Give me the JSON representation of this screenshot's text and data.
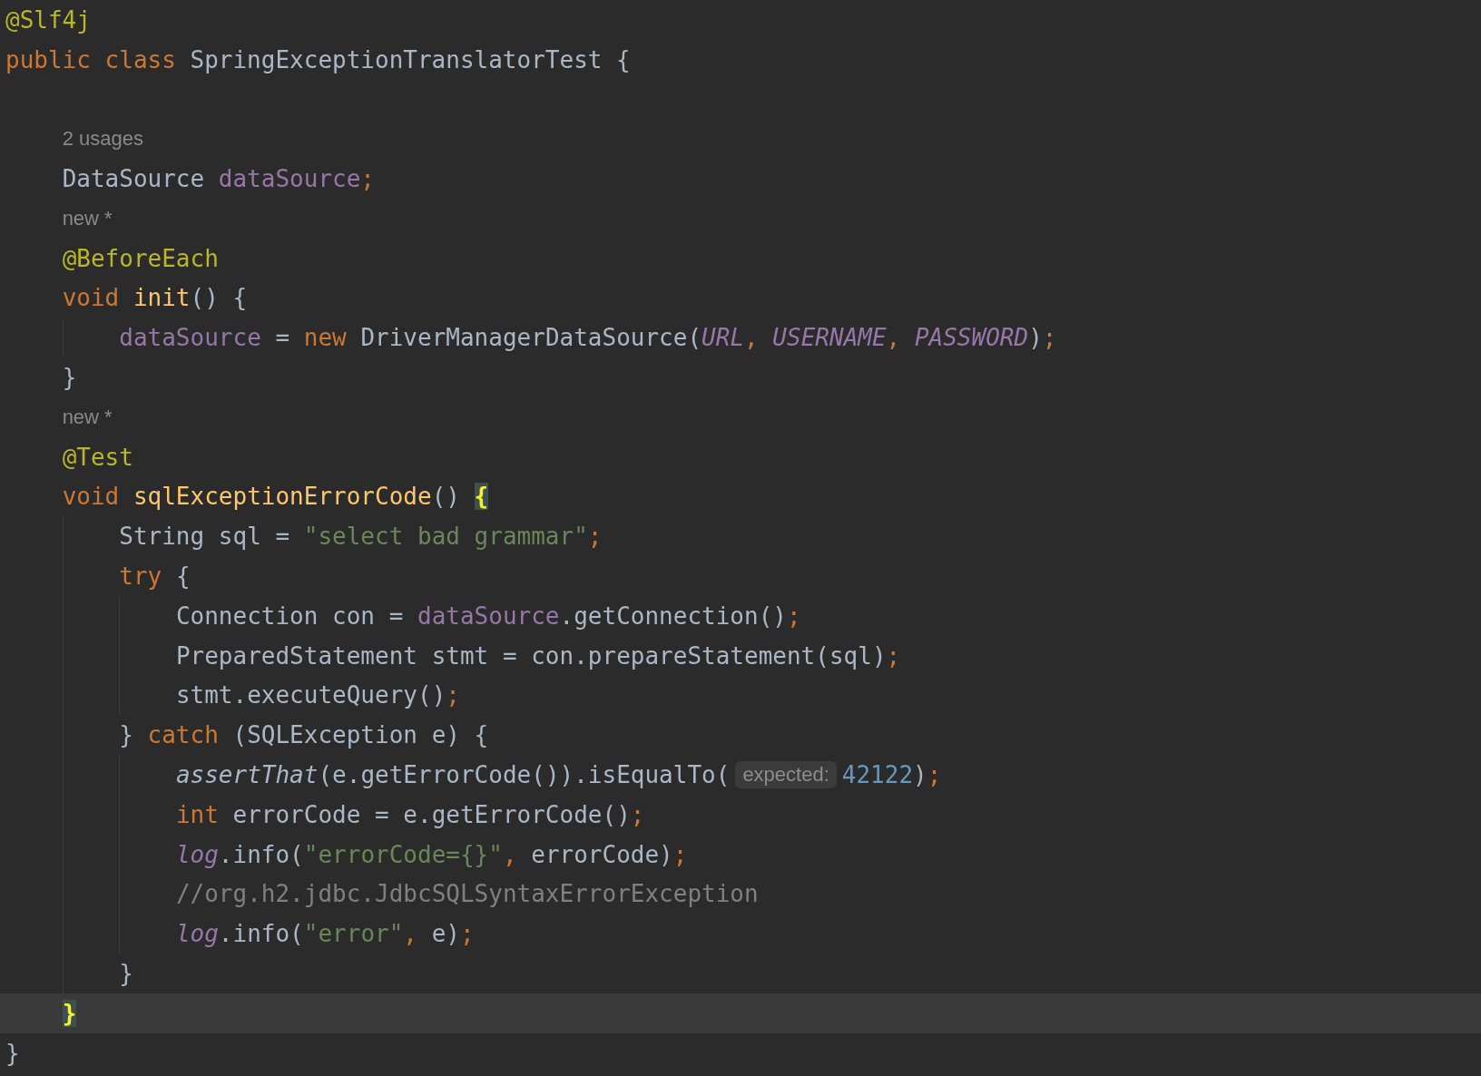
{
  "editor": {
    "lines": [
      {
        "kind": "code",
        "current": false,
        "tokens": [
          {
            "kind": "annotation",
            "text": "@Slf4j"
          }
        ]
      },
      {
        "kind": "code",
        "current": false,
        "tokens": [
          {
            "kind": "keyword",
            "text": "public class "
          },
          {
            "kind": "plain",
            "text": "SpringExceptionTranslatorTest {"
          }
        ]
      },
      {
        "kind": "code",
        "current": false
      },
      {
        "kind": "lens",
        "current": false,
        "text": "2 usages"
      },
      {
        "kind": "code",
        "current": false,
        "tokens": [
          {
            "kind": "plain",
            "text": "    DataSource "
          },
          {
            "kind": "field",
            "text": "dataSource"
          },
          {
            "kind": "keyword",
            "text": ";"
          }
        ]
      },
      {
        "kind": "lens",
        "current": false,
        "text": "new *"
      },
      {
        "kind": "code",
        "current": false,
        "tokens": [
          {
            "kind": "annotation",
            "text": "    @BeforeEach"
          }
        ]
      },
      {
        "kind": "code",
        "current": false,
        "tokens": [
          {
            "kind": "keyword",
            "text": "    void "
          },
          {
            "kind": "method",
            "text": "init"
          },
          {
            "kind": "plain",
            "text": "() {"
          }
        ]
      },
      {
        "kind": "code",
        "current": false,
        "tokens": [
          {
            "kind": "field",
            "text": "        dataSource"
          },
          {
            "kind": "plain",
            "text": " = "
          },
          {
            "kind": "keyword",
            "text": "new "
          },
          {
            "kind": "plain",
            "text": "DriverManagerDataSource("
          },
          {
            "kind": "constant",
            "text": "URL"
          },
          {
            "kind": "keyword",
            "text": ", "
          },
          {
            "kind": "constant",
            "text": "USERNAME"
          },
          {
            "kind": "keyword",
            "text": ", "
          },
          {
            "kind": "constant",
            "text": "PASSWORD"
          },
          {
            "kind": "plain",
            "text": ")"
          },
          {
            "kind": "keyword",
            "text": ";"
          }
        ]
      },
      {
        "kind": "code",
        "current": false,
        "tokens": [
          {
            "kind": "plain",
            "text": "    }"
          }
        ]
      },
      {
        "kind": "lens",
        "current": false,
        "text": "new *"
      },
      {
        "kind": "code",
        "current": false,
        "tokens": [
          {
            "kind": "annotation",
            "text": "    @Test"
          }
        ]
      },
      {
        "kind": "code",
        "current": false,
        "tokens": [
          {
            "kind": "keyword",
            "text": "    void "
          },
          {
            "kind": "method",
            "text": "sqlExceptionErrorCode"
          },
          {
            "kind": "plain",
            "text": "() "
          },
          {
            "kind": "brace-match",
            "text": "{"
          }
        ]
      },
      {
        "kind": "code",
        "current": false,
        "tokens": [
          {
            "kind": "plain",
            "text": "        String sql = "
          },
          {
            "kind": "string",
            "text": "\"select bad grammar\""
          },
          {
            "kind": "keyword",
            "text": ";"
          }
        ]
      },
      {
        "kind": "code",
        "current": false,
        "tokens": [
          {
            "kind": "keyword",
            "text": "        try "
          },
          {
            "kind": "plain",
            "text": "{"
          }
        ]
      },
      {
        "kind": "code",
        "current": false,
        "tokens": [
          {
            "kind": "plain",
            "text": "            Connection con = "
          },
          {
            "kind": "field",
            "text": "dataSource"
          },
          {
            "kind": "plain",
            "text": ".getConnection()"
          },
          {
            "kind": "keyword",
            "text": ";"
          }
        ]
      },
      {
        "kind": "code",
        "current": false,
        "tokens": [
          {
            "kind": "plain",
            "text": "            PreparedStatement stmt = con.prepareStatement(sql)"
          },
          {
            "kind": "keyword",
            "text": ";"
          }
        ]
      },
      {
        "kind": "code",
        "current": false,
        "tokens": [
          {
            "kind": "plain",
            "text": "            stmt.executeQuery()"
          },
          {
            "kind": "keyword",
            "text": ";"
          }
        ]
      },
      {
        "kind": "code",
        "current": false,
        "tokens": [
          {
            "kind": "plain",
            "text": "        } "
          },
          {
            "kind": "keyword",
            "text": "catch "
          },
          {
            "kind": "plain",
            "text": "(SQLException e) {"
          }
        ]
      },
      {
        "kind": "code",
        "current": false,
        "tokens": [
          {
            "kind": "static-call",
            "text": "            assertThat"
          },
          {
            "kind": "plain",
            "text": "(e.getErrorCode()).isEqualTo("
          },
          {
            "kind": "hint",
            "text": "expected:"
          },
          {
            "kind": "number",
            "text": "42122"
          },
          {
            "kind": "plain",
            "text": ")"
          },
          {
            "kind": "keyword",
            "text": ";"
          }
        ]
      },
      {
        "kind": "code",
        "current": false,
        "tokens": [
          {
            "kind": "keyword",
            "text": "            int "
          },
          {
            "kind": "plain",
            "text": "errorCode = e.getErrorCode()"
          },
          {
            "kind": "keyword",
            "text": ";"
          }
        ]
      },
      {
        "kind": "code",
        "current": false,
        "tokens": [
          {
            "kind": "constant",
            "text": "            log"
          },
          {
            "kind": "plain",
            "text": ".info("
          },
          {
            "kind": "string",
            "text": "\"errorCode={}\""
          },
          {
            "kind": "keyword",
            "text": ", "
          },
          {
            "kind": "plain",
            "text": "errorCode)"
          },
          {
            "kind": "keyword",
            "text": ";"
          }
        ]
      },
      {
        "kind": "code",
        "current": false,
        "tokens": [
          {
            "kind": "comment",
            "text": "            //org.h2.jdbc.JdbcSQLSyntaxErrorException"
          }
        ]
      },
      {
        "kind": "code",
        "current": false,
        "tokens": [
          {
            "kind": "constant",
            "text": "            log"
          },
          {
            "kind": "plain",
            "text": ".info("
          },
          {
            "kind": "string",
            "text": "\"error\""
          },
          {
            "kind": "keyword",
            "text": ", "
          },
          {
            "kind": "plain",
            "text": "e)"
          },
          {
            "kind": "keyword",
            "text": ";"
          }
        ]
      },
      {
        "kind": "code",
        "current": false,
        "tokens": [
          {
            "kind": "plain",
            "text": "        }"
          }
        ]
      },
      {
        "kind": "code",
        "current": true,
        "tokens": [
          {
            "kind": "brace-match",
            "text": "    }"
          }
        ]
      },
      {
        "kind": "code",
        "current": false,
        "tokens": [
          {
            "kind": "plain",
            "text": "}"
          }
        ]
      }
    ]
  }
}
